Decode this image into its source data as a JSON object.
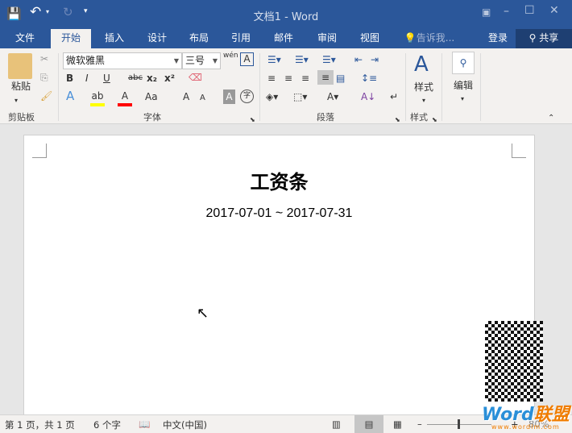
{
  "window": {
    "title": "文档1 - Word"
  },
  "qat": {
    "save": "save-icon",
    "undo": "undo-icon",
    "redo": "redo-icon",
    "customize": "▾"
  },
  "tabs": [
    {
      "label": "文件"
    },
    {
      "label": "开始"
    },
    {
      "label": "插入"
    },
    {
      "label": "设计"
    },
    {
      "label": "布局"
    },
    {
      "label": "引用"
    },
    {
      "label": "邮件"
    },
    {
      "label": "审阅"
    },
    {
      "label": "视图"
    }
  ],
  "tell_me": "告诉我...",
  "login": "登录",
  "share": "共享",
  "ribbon": {
    "clipboard": {
      "label": "剪贴板",
      "paste": "粘贴"
    },
    "font": {
      "label": "字体",
      "font_name": "微软雅黑",
      "font_size": "三号",
      "bold": "B",
      "italic": "I",
      "underline": "U",
      "strike": "abc",
      "sub": "x₂",
      "sup": "x²",
      "phonetic": "wén",
      "grow": "A",
      "shrink": "A",
      "case": "Aa",
      "char_shade": "A",
      "enclose": "字",
      "effects": "A",
      "highlight_color": "#ffff00",
      "font_color": "#ff0000"
    },
    "paragraph": {
      "label": "段落"
    },
    "styles": {
      "label": "样式",
      "button": "样式"
    },
    "editing": {
      "button": "编辑"
    }
  },
  "document": {
    "title": "工资条",
    "subtitle": "2017-07-01 ~ 2017-07-31"
  },
  "status": {
    "page": "第 1 页，共 1 页",
    "words": "6 个字",
    "language": "中文(中国)",
    "zoom": "80%",
    "zoom_value": 80
  },
  "watermark": {
    "brand": "Word联盟",
    "url": "www.wordlm.com"
  }
}
